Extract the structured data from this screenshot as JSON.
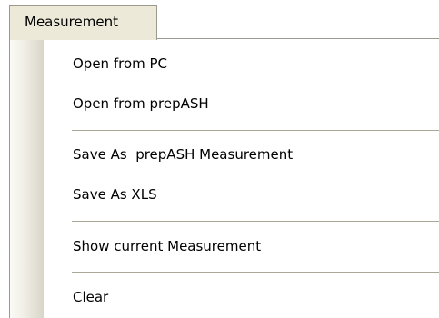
{
  "menubar": {
    "title": "Measurement"
  },
  "menu": {
    "items": [
      {
        "label": "Open from PC"
      },
      {
        "label": "Open from prepASH"
      },
      {
        "label": "Save As  prepASH Measurement"
      },
      {
        "label": "Save As XLS"
      },
      {
        "label": "Show current Measurement"
      },
      {
        "label": "Clear"
      }
    ]
  }
}
